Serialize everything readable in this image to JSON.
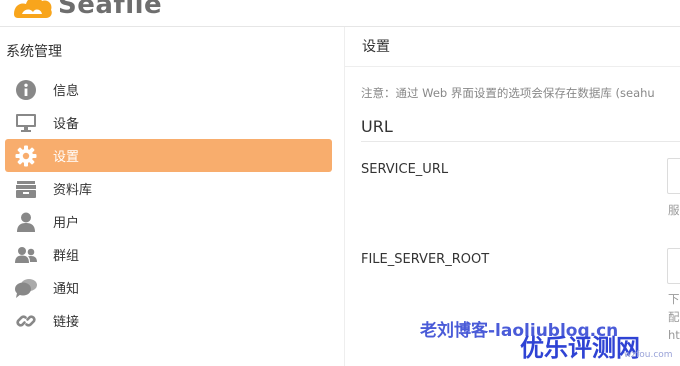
{
  "brand": {
    "name": "Seafile"
  },
  "sidebar": {
    "title": "系统管理",
    "items": [
      {
        "label": "信息",
        "icon": "info-icon",
        "active": false
      },
      {
        "label": "设备",
        "icon": "monitor-icon",
        "active": false
      },
      {
        "label": "设置",
        "icon": "gear-icon",
        "active": true
      },
      {
        "label": "资料库",
        "icon": "library-icon",
        "active": false
      },
      {
        "label": "用户",
        "icon": "user-icon",
        "active": false
      },
      {
        "label": "群组",
        "icon": "group-icon",
        "active": false
      },
      {
        "label": "通知",
        "icon": "notification-icon",
        "active": false
      },
      {
        "label": "链接",
        "icon": "link-icon",
        "active": false
      }
    ]
  },
  "main": {
    "title": "设置",
    "notice": "注意：通过 Web 界面设置的选项会保存在数据库 (seahu",
    "section": "URL",
    "fields": [
      {
        "label": "SERVICE_URL",
        "help": "服"
      },
      {
        "label": "FILE_SERVER_ROOT",
        "help_lines": [
          "下",
          "配",
          "ht"
        ]
      }
    ]
  },
  "watermarks": {
    "blog": "老刘博客-laoliublog.cn",
    "site": "优乐评测网",
    "site_url": "wzfou.com"
  },
  "colors": {
    "accent": "#f8ad6d",
    "logo": "#f8a51c",
    "icon": "#888888",
    "watermark_blog": "#4a5bd8",
    "watermark_site": "#2f43d4"
  }
}
